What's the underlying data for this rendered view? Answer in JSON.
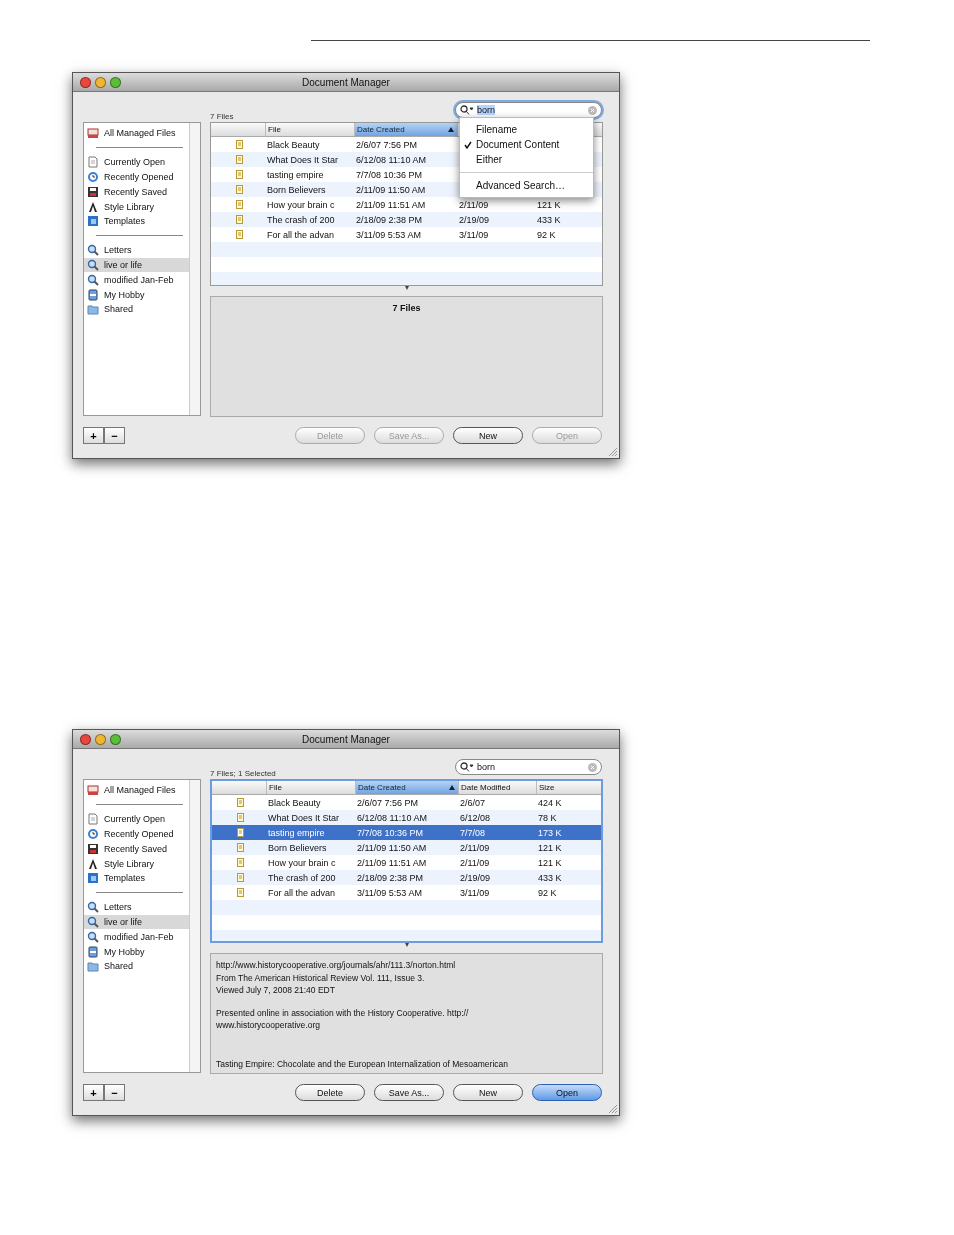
{
  "windows": [
    {
      "title": "Document Manager",
      "count": "7 Files",
      "search": {
        "value": "born",
        "focused": true
      },
      "sidebar": {
        "groups": [
          [
            {
              "label": "All Managed Files",
              "kind": "drive",
              "selected": false
            }
          ],
          [
            {
              "label": "Currently Open",
              "kind": "page",
              "selected": false
            },
            {
              "label": "Recently Opened",
              "kind": "clock",
              "selected": false
            },
            {
              "label": "Recently Saved",
              "kind": "disk",
              "selected": false
            },
            {
              "label": "Style Library",
              "kind": "style",
              "selected": false
            },
            {
              "label": "Templates",
              "kind": "template",
              "selected": false
            }
          ],
          [
            {
              "label": "Letters",
              "kind": "search",
              "selected": false
            },
            {
              "label": "live or life",
              "kind": "search",
              "selected": true
            },
            {
              "label": "modified Jan-Feb",
              "kind": "search",
              "selected": false
            },
            {
              "label": "My Hobby",
              "kind": "hobby",
              "selected": false
            },
            {
              "label": "Shared",
              "kind": "folder",
              "selected": false
            }
          ]
        ]
      },
      "table": {
        "focused": false,
        "columns": [
          {
            "label": "File",
            "sorted": false
          },
          {
            "label": "Date Created",
            "sorted": true
          }
        ],
        "rows": [
          {
            "file": "Black Beauty",
            "created": "2/6/07 7:56 PM",
            "selected": false
          },
          {
            "file": "What Does It Star",
            "created": "6/12/08 11:10 AM",
            "selected": false
          },
          {
            "file": "tasting empire",
            "created": "7/7/08 10:36 PM",
            "selected": false
          },
          {
            "file": "Born Believers",
            "created": "2/11/09 11:50 AM",
            "selected": false
          },
          {
            "file": "How your brain c",
            "created": "2/11/09 11:51 AM",
            "modified": "2/11/09",
            "size": "121 K",
            "selected": false
          },
          {
            "file": "The crash of 200",
            "created": "2/18/09 2:38 PM",
            "modified": "2/19/09",
            "size": "433 K",
            "selected": false
          },
          {
            "file": "For all the advan",
            "created": "3/11/09 5:53 AM",
            "modified": "3/11/09",
            "size": "92 K",
            "selected": false
          }
        ]
      },
      "preview": {
        "kind": "summary",
        "text": "7 Files"
      },
      "sidebar_buttons": [
        "+",
        "−"
      ],
      "buttons": [
        {
          "label": "Delete",
          "disabled": true,
          "default": false
        },
        {
          "label": "Save As...",
          "disabled": true,
          "default": false
        },
        {
          "label": "New",
          "disabled": false,
          "default": false
        },
        {
          "label": "Open",
          "disabled": true,
          "default": false
        }
      ],
      "search_menu": {
        "options": [
          {
            "label": "Filename",
            "checked": false
          },
          {
            "label": "Document Content",
            "checked": true
          },
          {
            "label": "Either",
            "checked": false
          }
        ],
        "commands": [
          "Advanced Search…"
        ]
      }
    },
    {
      "title": "Document Manager",
      "count": "7 Files; 1 Selected",
      "search": {
        "value": "born",
        "focused": false
      },
      "sidebar": {
        "groups": [
          [
            {
              "label": "All Managed Files",
              "kind": "drive",
              "selected": false
            }
          ],
          [
            {
              "label": "Currently Open",
              "kind": "page",
              "selected": false
            },
            {
              "label": "Recently Opened",
              "kind": "clock",
              "selected": false
            },
            {
              "label": "Recently Saved",
              "kind": "disk",
              "selected": false
            },
            {
              "label": "Style Library",
              "kind": "style",
              "selected": false
            },
            {
              "label": "Templates",
              "kind": "template",
              "selected": false
            }
          ],
          [
            {
              "label": "Letters",
              "kind": "search",
              "selected": false
            },
            {
              "label": "live or life",
              "kind": "search",
              "selected": true
            },
            {
              "label": "modified Jan-Feb",
              "kind": "search",
              "selected": false
            },
            {
              "label": "My Hobby",
              "kind": "hobby",
              "selected": false
            },
            {
              "label": "Shared",
              "kind": "folder",
              "selected": false
            }
          ]
        ]
      },
      "table": {
        "focused": true,
        "columns": [
          {
            "label": "File",
            "sorted": false
          },
          {
            "label": "Date Created",
            "sorted": true
          },
          {
            "label": "Date Modified",
            "sorted": false
          },
          {
            "label": "Size",
            "sorted": false
          }
        ],
        "rows": [
          {
            "file": "Black Beauty",
            "created": "2/6/07 7:56 PM",
            "modified": "2/6/07",
            "size": "424 K",
            "selected": false
          },
          {
            "file": "What Does It Star",
            "created": "6/12/08 11:10 AM",
            "modified": "6/12/08",
            "size": "78 K",
            "selected": false
          },
          {
            "file": "tasting empire",
            "created": "7/7/08 10:36 PM",
            "modified": "7/7/08",
            "size": "173 K",
            "selected": true
          },
          {
            "file": "Born Believers",
            "created": "2/11/09 11:50 AM",
            "modified": "2/11/09",
            "size": "121 K",
            "selected": false
          },
          {
            "file": "How your brain c",
            "created": "2/11/09 11:51 AM",
            "modified": "2/11/09",
            "size": "121 K",
            "selected": false
          },
          {
            "file": "The crash of 200",
            "created": "2/18/09 2:38 PM",
            "modified": "2/19/09",
            "size": "433 K",
            "selected": false
          },
          {
            "file": "For all the advan",
            "created": "3/11/09 5:53 AM",
            "modified": "3/11/09",
            "size": "92 K",
            "selected": false
          }
        ]
      },
      "preview": {
        "kind": "notes",
        "paragraphs": [
          [
            "http://www.historycooperative.org/journals/ahr/111.3/norton.html",
            "From The American Historical Review Vol. 111, Issue 3.",
            "Viewed July 7, 2008 21:40 EDT"
          ],
          [
            "Presented online in association with the History Cooperative. http://",
            "www.historycooperative.org"
          ],
          [
            "Tasting Empire: Chocolate and the European Internalization of Mesoamerican"
          ]
        ]
      },
      "sidebar_buttons": [
        "+",
        "−"
      ],
      "buttons": [
        {
          "label": "Delete",
          "disabled": false,
          "default": false
        },
        {
          "label": "Save As...",
          "disabled": false,
          "default": false
        },
        {
          "label": "New",
          "disabled": false,
          "default": false
        },
        {
          "label": "Open",
          "disabled": false,
          "default": true
        }
      ]
    }
  ]
}
